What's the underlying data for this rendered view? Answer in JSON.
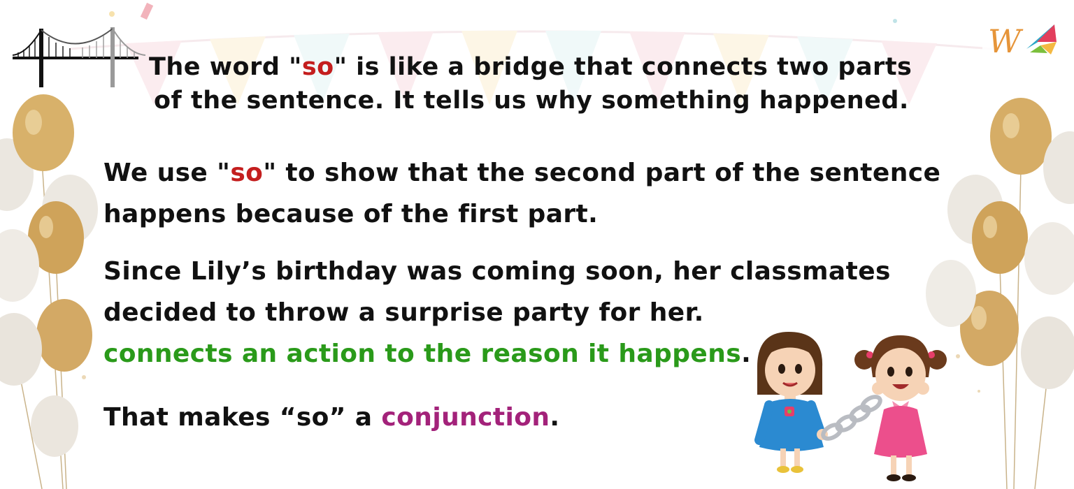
{
  "intro": {
    "line1_before": "The word \"",
    "line1_highlight": "so",
    "line1_after": "\" is like a bridge that connects two parts",
    "line2": "of the sentence. It tells us why something happened."
  },
  "explanation": {
    "line1_before": "We use \"",
    "line1_highlight": "so",
    "line1_after": "\" to show that the second part of the sentence",
    "line2": "happens because of the first part."
  },
  "example": {
    "line1": "Since Lily’s birthday was coming soon, her classmates",
    "line2": "decided to throw a surprise party for her."
  },
  "note": {
    "highlight": "connects an action to the reason it happens",
    "end": "."
  },
  "conclusion": {
    "before": "That makes “so” a ",
    "highlight": "conjunction",
    "end": "."
  },
  "logo": {
    "letter": "W"
  },
  "colors": {
    "so_highlight": "#c41e1e",
    "note_green": "#2a9a1a",
    "conjunction_purple": "#a3227a",
    "text": "#111111",
    "balloon_gold": "#d9b370",
    "balloon_white": "#efece6",
    "bunting": "#f7d6dc"
  },
  "icons": [
    "bridge-icon",
    "balloon-cluster",
    "two-girls-holding-chain-illustration",
    "logo-icon"
  ]
}
